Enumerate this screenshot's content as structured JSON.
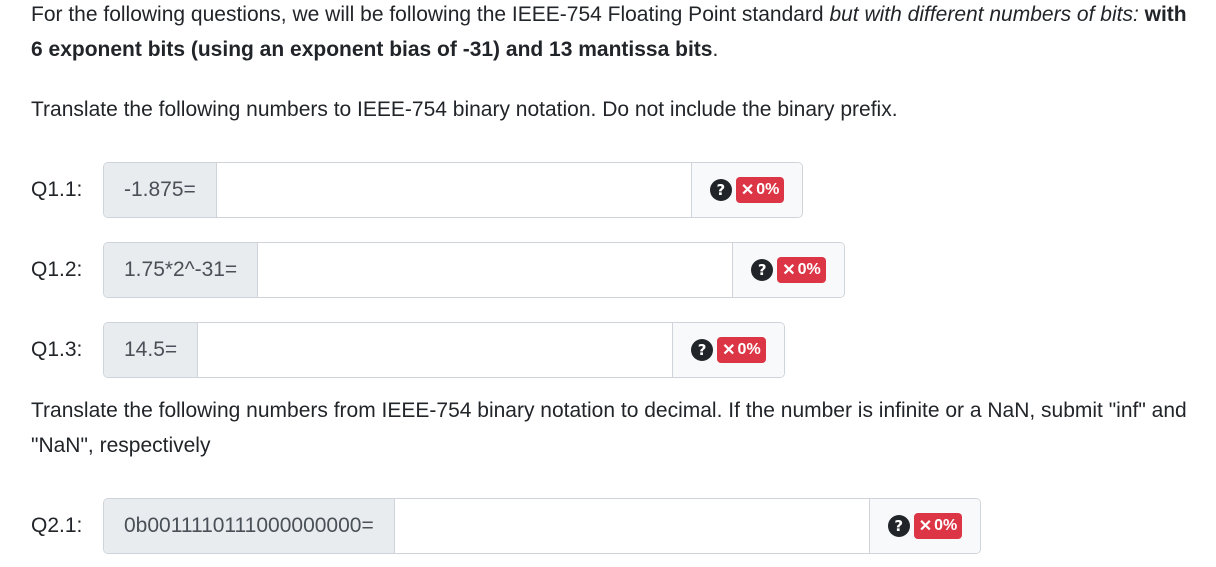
{
  "intro": {
    "part1": "For the following questions, we will be following the IEEE-754 Floating Point standard ",
    "italic": "but with different numbers of bits:",
    "bold": " with 6 exponent bits (using an exponent bias of -31) and 13 mantissa bits",
    "end": "."
  },
  "instructions": {
    "to_binary": "Translate the following numbers to IEEE-754 binary notation. Do not include the binary prefix.",
    "to_decimal": "Translate the following numbers from IEEE-754 binary notation to decimal. If the number is infinite or a NaN, submit \"inf\" and \"NaN\", respectively"
  },
  "questions": [
    {
      "label": "Q1.1:",
      "prompt": "-1.875=",
      "value": "",
      "help": "?",
      "score": "0%",
      "score_icon": "✕"
    },
    {
      "label": "Q1.2:",
      "prompt": "1.75*2^-31=",
      "value": "",
      "help": "?",
      "score": "0%",
      "score_icon": "✕"
    },
    {
      "label": "Q1.3:",
      "prompt": "14.5=",
      "value": "",
      "help": "?",
      "score": "0%",
      "score_icon": "✕"
    },
    {
      "label": "Q2.1:",
      "prompt": "0b0011110111000000000=",
      "value": "",
      "help": "?",
      "score": "0%",
      "score_icon": "✕"
    }
  ],
  "colors": {
    "score_badge": "#dc3545",
    "help_icon": "#212529",
    "prefix_bg": "#e9ecef"
  }
}
